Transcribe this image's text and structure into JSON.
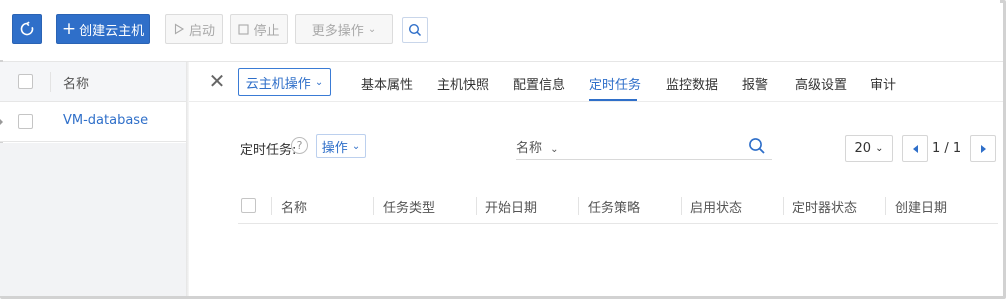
{
  "toolbar": {
    "create_label": "创建云主机",
    "start_label": "启动",
    "stop_label": "停止",
    "more_label": "更多操作"
  },
  "left_list": {
    "header_name": "名称",
    "rows": [
      {
        "name": "VM-database"
      }
    ]
  },
  "detail": {
    "vm_ops_label": "云主机操作",
    "tabs": [
      {
        "label": "基本属性"
      },
      {
        "label": "主机快照"
      },
      {
        "label": "配置信息"
      },
      {
        "label": "定时任务",
        "active": true
      },
      {
        "label": "监控数据"
      },
      {
        "label": "报警"
      },
      {
        "label": "高级设置"
      },
      {
        "label": "审计"
      }
    ],
    "scheduled_label": "定时任务:",
    "help_glyph": "?",
    "ops_label": "操作",
    "filter_label": "名称",
    "page_size": "20",
    "page_info": "1 / 1",
    "columns": [
      "名称",
      "任务类型",
      "开始日期",
      "任务策略",
      "启用状态",
      "定时器状态",
      "创建日期"
    ]
  },
  "colors": {
    "accent": "#2f6fc9",
    "disabled_text": "#a9a9a9",
    "border": "#e6e6e6"
  }
}
